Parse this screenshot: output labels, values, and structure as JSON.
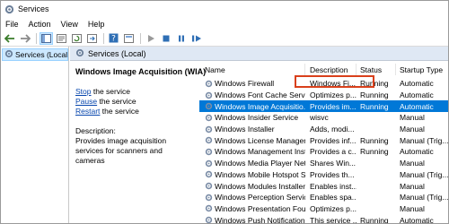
{
  "window": {
    "title": "Services"
  },
  "menu": [
    "File",
    "Action",
    "View",
    "Help"
  ],
  "toolbar": {
    "icons": [
      "back-icon",
      "forward-icon",
      "console-tree-icon",
      "properties-icon",
      "refresh-icon",
      "export-icon",
      "help-icon",
      "show-icon",
      "play-icon",
      "stop-icon",
      "pause-icon",
      "restart-icon"
    ]
  },
  "tree": {
    "item": "Services (Local)"
  },
  "main": {
    "header": "Services (Local)"
  },
  "detail": {
    "service_name": "Windows Image Acquisition (WIA)",
    "stop_link": "Stop",
    "stop_rest": " the service",
    "pause_link": "Pause",
    "pause_rest": " the service",
    "restart_link": "Restart",
    "restart_rest": " the service",
    "desc_label": "Description:",
    "desc_text": "Provides image acquisition services for scanners and cameras"
  },
  "columns": {
    "name": "Name",
    "description": "Description",
    "status": "Status",
    "startup": "Startup Type"
  },
  "rows": [
    {
      "name": "Windows Firewall",
      "description": "Windows Fi...",
      "status": "Running",
      "startup": "Automatic",
      "selected": false
    },
    {
      "name": "Windows Font Cache Service",
      "description": "Optimizes p...",
      "status": "Running",
      "startup": "Automatic",
      "selected": false
    },
    {
      "name": "Windows Image Acquisitio...",
      "description": "Provides im...",
      "status": "Running",
      "startup": "Automatic",
      "selected": true
    },
    {
      "name": "Windows Insider Service",
      "description": "wisvc",
      "status": "",
      "startup": "Manual",
      "selected": false
    },
    {
      "name": "Windows Installer",
      "description": "Adds, modi...",
      "status": "",
      "startup": "Manual",
      "selected": false
    },
    {
      "name": "Windows License Manager ...",
      "description": "Provides inf...",
      "status": "Running",
      "startup": "Manual (Trig...",
      "selected": false
    },
    {
      "name": "Windows Management Inst...",
      "description": "Provides a c...",
      "status": "Running",
      "startup": "Automatic",
      "selected": false
    },
    {
      "name": "Windows Media Player Net...",
      "description": "Shares Win...",
      "status": "",
      "startup": "Manual",
      "selected": false
    },
    {
      "name": "Windows Mobile Hotspot S...",
      "description": "Provides th...",
      "status": "",
      "startup": "Manual (Trig...",
      "selected": false
    },
    {
      "name": "Windows Modules Installer",
      "description": "Enables inst...",
      "status": "",
      "startup": "Manual",
      "selected": false
    },
    {
      "name": "Windows Perception Service",
      "description": "Enables spa...",
      "status": "",
      "startup": "Manual (Trig...",
      "selected": false
    },
    {
      "name": "Windows Presentation Fou...",
      "description": "Optimizes p...",
      "status": "",
      "startup": "Manual",
      "selected": false
    },
    {
      "name": "Windows Push Notification...",
      "description": "This service ...",
      "status": "Running",
      "startup": "Automatic",
      "selected": false
    }
  ],
  "colors": {
    "selection": "#0078d7",
    "highlight_box": "#d9401b",
    "link": "#0645ad"
  }
}
